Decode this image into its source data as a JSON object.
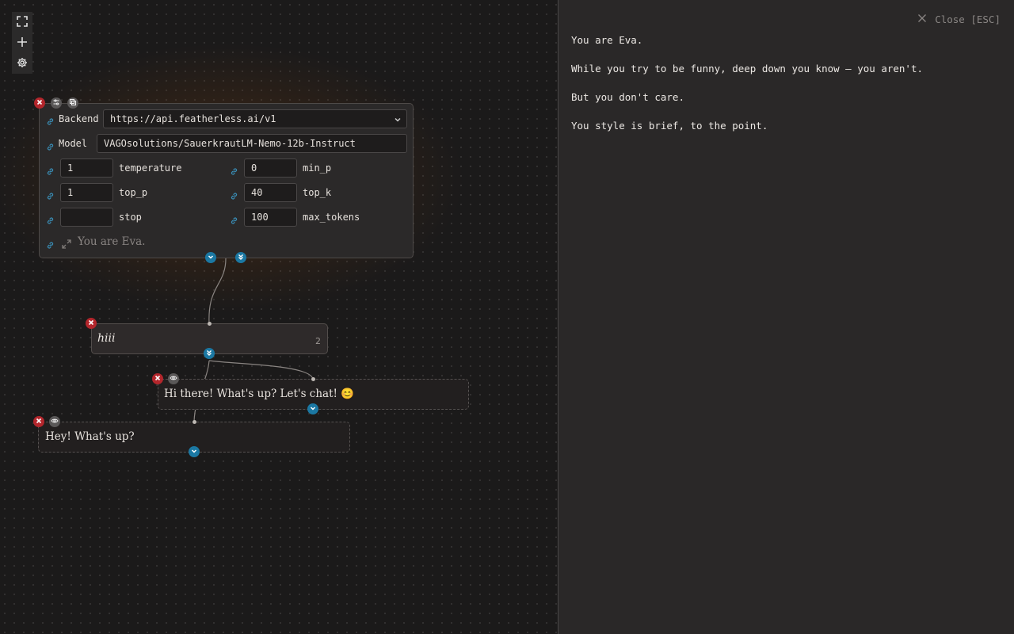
{
  "toolbar": {
    "buttons": [
      {
        "icon": "fullscreen-icon"
      },
      {
        "icon": "plus-icon"
      },
      {
        "icon": "gear-icon"
      }
    ]
  },
  "llm_node": {
    "backend_label": "Backend",
    "backend_value": "https://api.featherless.ai/v1",
    "model_label": "Model",
    "model_value": "VAGOsolutions/SauerkrautLM-Nemo-12b-Instruct",
    "params": {
      "temperature": {
        "label": "temperature",
        "value": "1"
      },
      "min_p": {
        "label": "min_p",
        "value": "0"
      },
      "top_p": {
        "label": "top_p",
        "value": "1"
      },
      "top_k": {
        "label": "top_k",
        "value": "40"
      },
      "stop": {
        "label": "stop",
        "value": ""
      },
      "max_tokens": {
        "label": "max_tokens",
        "value": "100"
      }
    },
    "system_preview": "You are Eva."
  },
  "user_node": {
    "text": "hiii",
    "count": "2"
  },
  "reply_nodes": [
    {
      "text": "Hi there! What's up? Let's chat! 😊"
    },
    {
      "text": "Hey! What's up?"
    }
  ],
  "editor": {
    "close_label": "Close [ESC]",
    "lines": [
      "You are Eva.",
      "While you try to be funny, deep down you know – you aren't.",
      "But you don't care.",
      "You style is brief, to the point."
    ]
  },
  "colors": {
    "accent_blue": "#1b78a3",
    "close_red": "#b3262c",
    "glow": "#96460a"
  }
}
